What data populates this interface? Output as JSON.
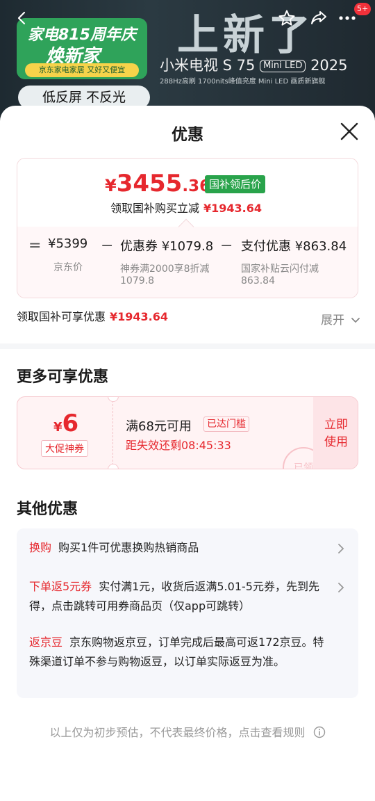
{
  "banner": {
    "promo_title": "家电815周年庆",
    "promo_sub": "焕新家",
    "promo_tag": "京东家电家居 又好又便宜",
    "chip": "低反屏 不反光",
    "headline": "上新了",
    "model_pre": "小米电视 S 75",
    "model_badge": "Mini LED",
    "model_post": "2025",
    "spec": "288Hz高刷 1700nits峰值亮度 Mini LED 画质新旗舰",
    "cart_badge": "5+"
  },
  "sheet": {
    "title": "优惠",
    "price": {
      "yen": "¥",
      "int": "3455",
      "dec": ".36",
      "tag": "国补领后价",
      "sub_label": "领取国补购买立减",
      "sub_value": "¥1943.64"
    },
    "formula": {
      "eq": "=",
      "minus": "−",
      "base_value": "¥5399",
      "base_label": "京东价",
      "coupon_value": "优惠券 ¥1079.8",
      "coupon_desc1": "神券满2000享8折减",
      "coupon_desc2": "1079.8",
      "pay_value": "支付优惠 ¥863.84",
      "pay_desc1": "国家补贴云闪付减",
      "pay_desc2": "863.84"
    },
    "enjoy_label": "领取国补可享优惠",
    "enjoy_value": "¥1943.64",
    "expand": "展开"
  },
  "more": {
    "heading": "更多可享优惠",
    "coupon": {
      "yen": "¥",
      "amount": "6",
      "tag": "大促神券",
      "condition": "满68元可用",
      "reached": "已达门槛",
      "expire": "距失效还剩08:45:33",
      "use1": "立即",
      "use2": "使用",
      "stamp": "已领"
    }
  },
  "other": {
    "heading": "其他优惠",
    "rows": [
      {
        "key": "换购",
        "text": "购买1件可优惠换购热销商品"
      },
      {
        "key": "下单返5元券",
        "text": "实付满1元，收货后返满5.01-5元券，先到先得，点击跳转可用券商品页（仅app可跳转）"
      },
      {
        "key": "返京豆",
        "text": "京东购物返京豆，订单完成后最高可返172京豆。特殊渠道订单不参与购物返豆，以订单实际返豆为准。"
      }
    ]
  },
  "footer": "以上仅为初步预估，不代表最终价格，点击查看规则"
}
